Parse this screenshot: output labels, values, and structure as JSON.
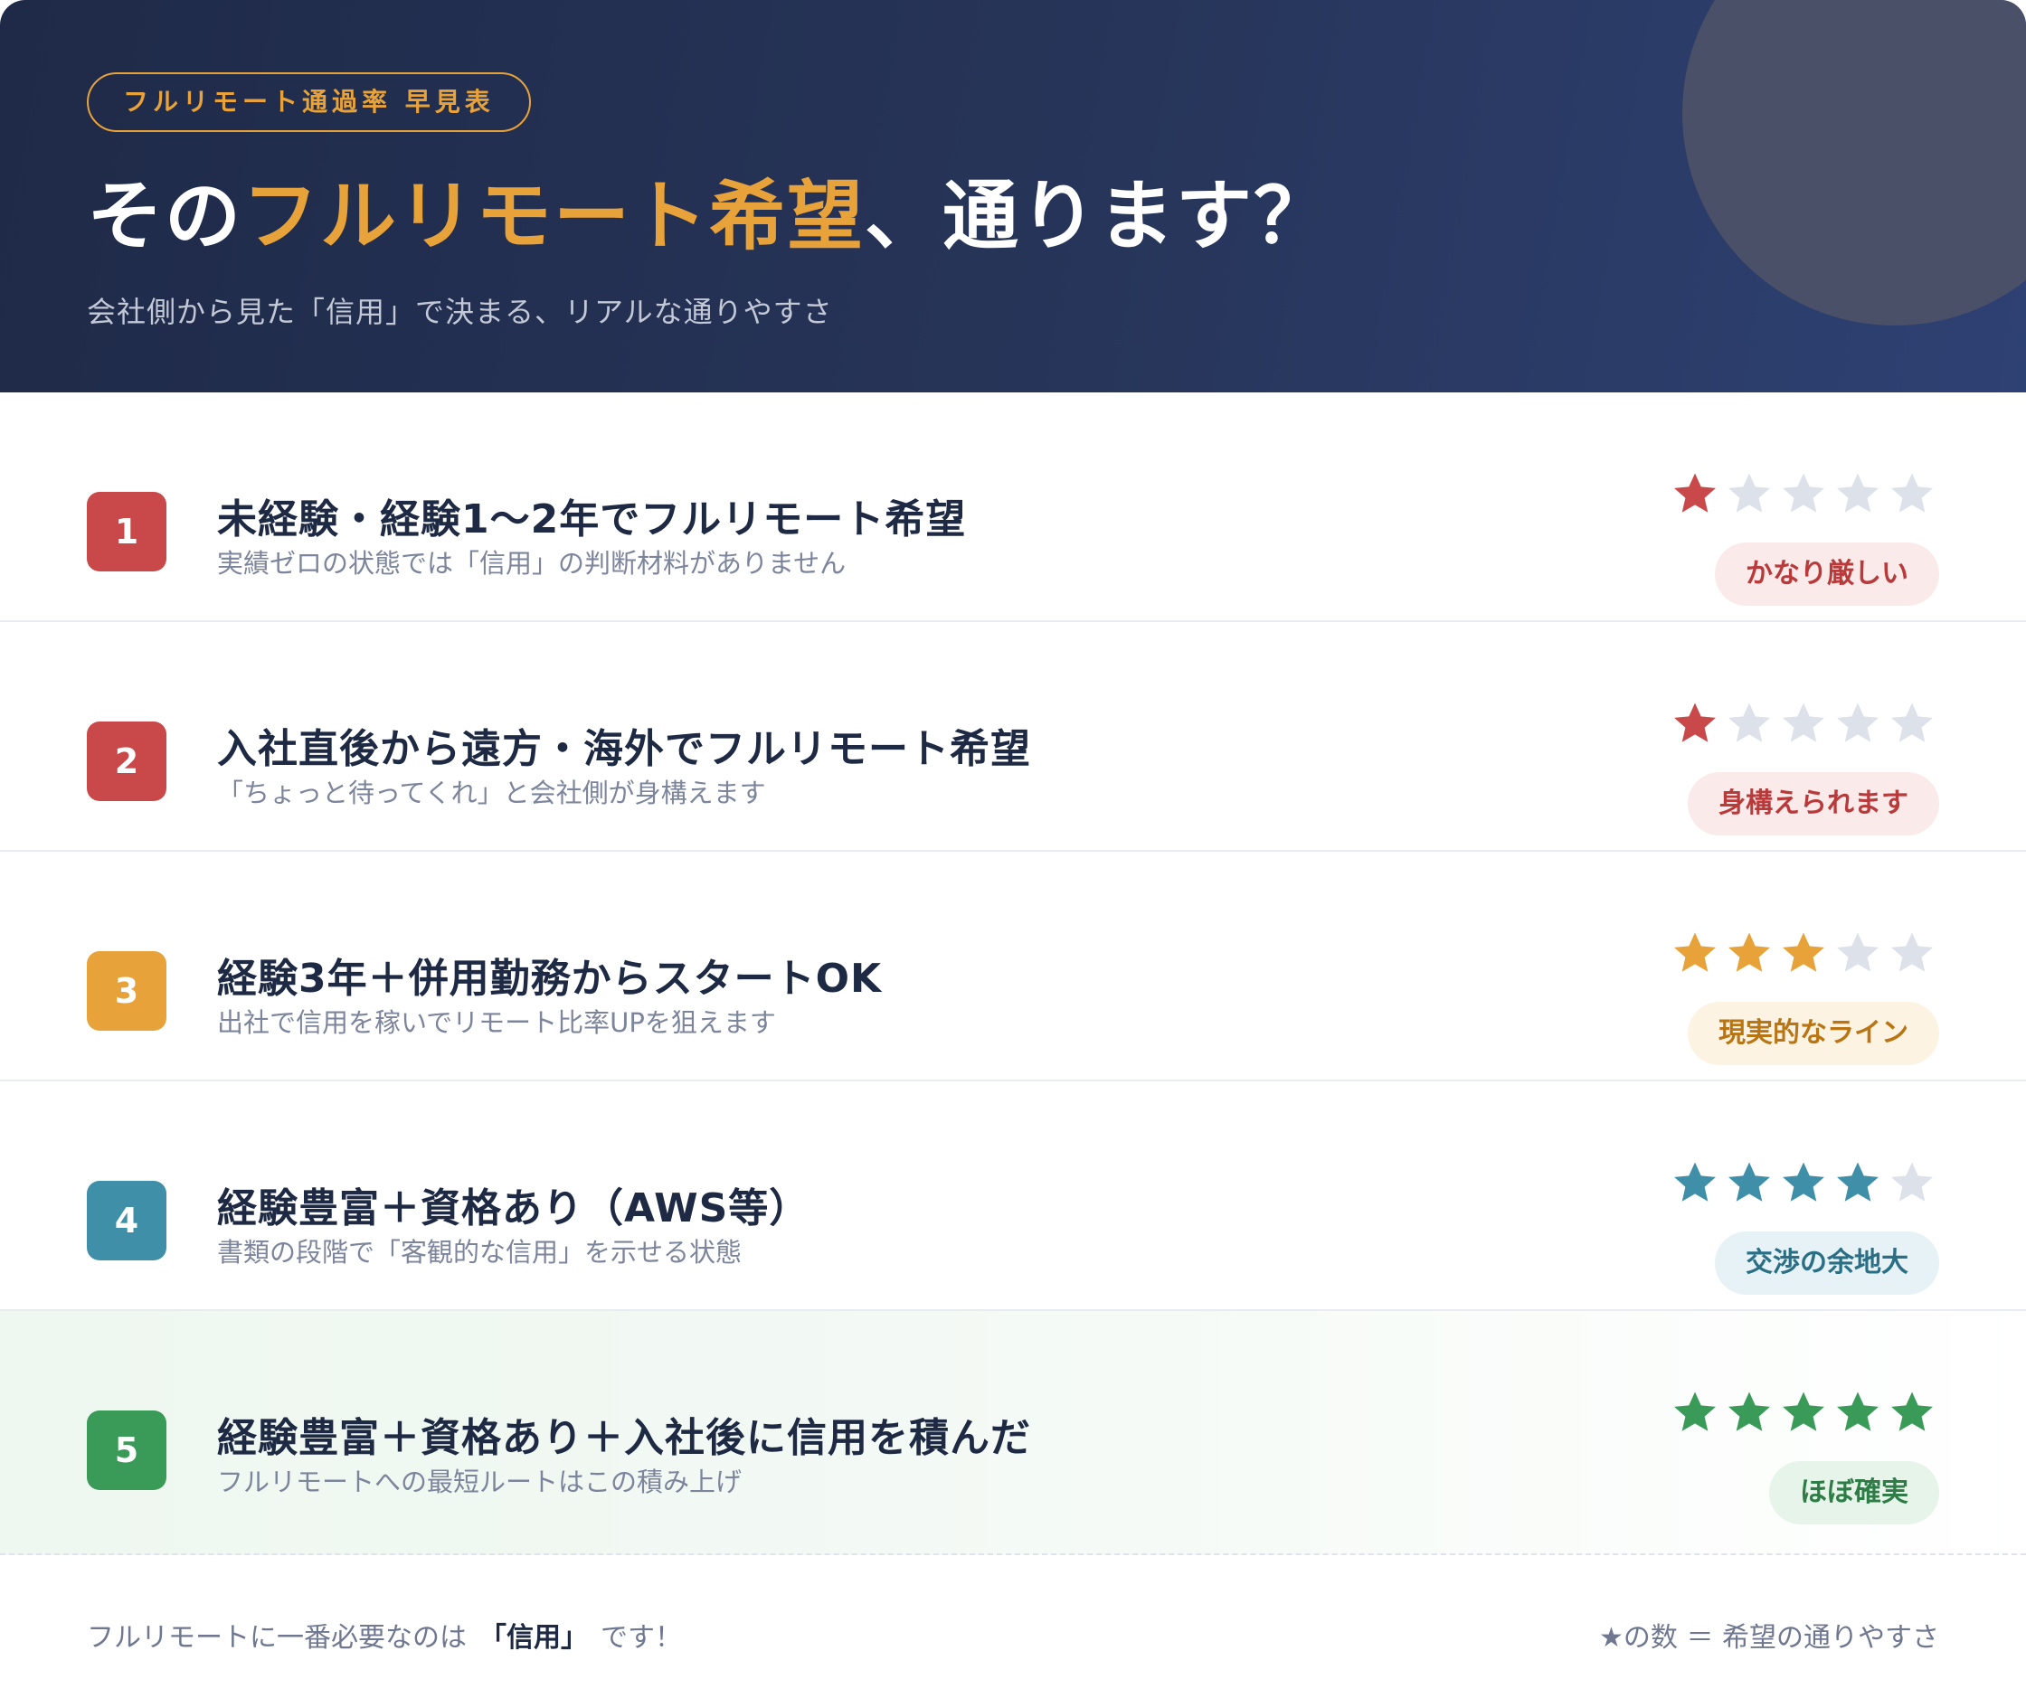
{
  "header": {
    "pill": "フルリモート通過率 早見表",
    "title_pre": "その",
    "title_accent": "フルリモート希望",
    "title_post": "、通ります？",
    "subtitle": "会社側から見た「信用」で決まる、リアルな通りやすさ"
  },
  "rows": [
    {
      "num": "1",
      "title": "未経験・経験1〜2年でフルリモート希望",
      "desc": "実績ゼロの状態では「信用」の判断材料がありません",
      "stars": 1,
      "badge": "かなり厳しい",
      "color": "#c9494a",
      "badge_bg": "#fbeaea",
      "badge_color": "#b83a3b"
    },
    {
      "num": "2",
      "title": "入社直後から遠方・海外でフルリモート希望",
      "desc": "「ちょっと待ってくれ」と会社側が身構えます",
      "stars": 1,
      "badge": "身構えられます",
      "color": "#c9494a",
      "badge_bg": "#fbeaea",
      "badge_color": "#b83a3b"
    },
    {
      "num": "3",
      "title": "経験3年＋併用勤務からスタートOK",
      "desc": "出社で信用を稼いでリモート比率UPを狙えます",
      "stars": 3,
      "badge": "現実的なライン",
      "color": "#e8a23a",
      "badge_bg": "#fdf3e3",
      "badge_color": "#b97513"
    },
    {
      "num": "4",
      "title": "経験豊富＋資格あり（AWS等）",
      "desc": "書類の段階で「客観的な信用」を示せる状態",
      "stars": 4,
      "badge": "交渉の余地大",
      "color": "#3f8fa8",
      "badge_bg": "#e6f2f6",
      "badge_color": "#2b6f86"
    },
    {
      "num": "5",
      "title": "経験豊富＋資格あり＋入社後に信用を積んだ",
      "desc": "フルリモートへの最短ルートはこの積み上げ",
      "stars": 5,
      "badge": "ほぼ確実",
      "color": "#3a9a57",
      "badge_bg": "#e6f4ea",
      "badge_color": "#2e7d46"
    }
  ],
  "footer": {
    "left_pre": "フルリモートに一番必要なのは",
    "left_bold": "「信用」",
    "left_post": "です！",
    "right": "★の数 ＝ 希望の通りやすさ"
  },
  "colors": {
    "star_empty": "#dde1ea",
    "header_accent": "#e8a23a"
  }
}
